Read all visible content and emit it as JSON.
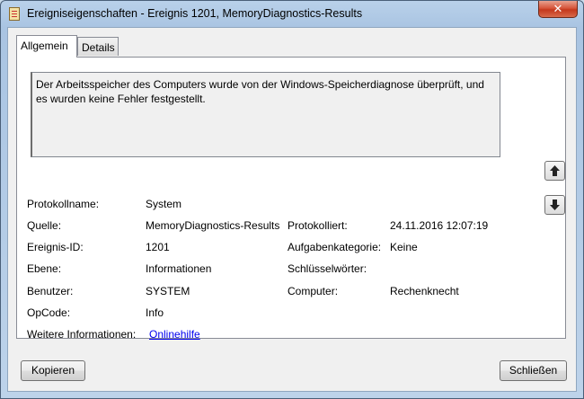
{
  "window": {
    "title": "Ereigniseigenschaften - Ereignis 1201, MemoryDiagnostics-Results",
    "close_label": "✕"
  },
  "tabs": [
    {
      "label": "Allgemein",
      "active": true
    },
    {
      "label": "Details",
      "active": false
    }
  ],
  "description": "Der Arbeitsspeicher des Computers wurde von der Windows-Speicherdiagnose überprüft, und es wurden keine Fehler festgestellt.",
  "fields": {
    "protokollname_label": "Protokollname:",
    "protokollname_value": "System",
    "quelle_label": "Quelle:",
    "quelle_value": "MemoryDiagnostics-Results",
    "protokolliert_label": "Protokolliert:",
    "protokolliert_value": "24.11.2016 12:07:19",
    "ereignis_id_label": "Ereignis-ID:",
    "ereignis_id_value": "1201",
    "aufgabenkategorie_label": "Aufgabenkategorie:",
    "aufgabenkategorie_value": "Keine",
    "ebene_label": "Ebene:",
    "ebene_value": "Informationen",
    "schluesselwoerter_label": "Schlüsselwörter:",
    "schluesselwoerter_value": "",
    "benutzer_label": "Benutzer:",
    "benutzer_value": "SYSTEM",
    "computer_label": "Computer:",
    "computer_value": "Rechenknecht",
    "opcode_label": "OpCode:",
    "opcode_value": "Info",
    "weitere_label": "Weitere Informationen:",
    "weitere_link": "Onlinehilfe"
  },
  "buttons": {
    "copy": "Kopieren",
    "close": "Schließen"
  },
  "icons": {
    "up": "arrow-up-icon",
    "down": "arrow-down-icon"
  }
}
